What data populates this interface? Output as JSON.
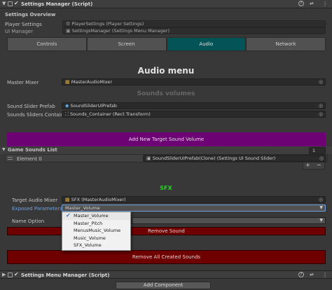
{
  "component1": {
    "title": "Settings Manager (Script)",
    "enabled_icon": "checkbox-icon",
    "help_icon": "?",
    "prefs_icon": "⇌",
    "menu_icon": "⋮"
  },
  "overview": {
    "title": "Settings Overview",
    "player_settings_label": "Player Settings",
    "player_settings_value": "PlayerSettings (Player Settings)",
    "ui_manager_label": "UI Manager",
    "ui_manager_value": "SettingsManager (Settings Menu Manager)"
  },
  "tabs": [
    {
      "label": "Controls",
      "active": false
    },
    {
      "label": "Screen",
      "active": false
    },
    {
      "label": "Audio",
      "active": true
    },
    {
      "label": "Network",
      "active": false
    }
  ],
  "audio": {
    "menu_title": "Audio menu",
    "master_mixer_label": "Master Mixer",
    "master_mixer_value": "MasterAudioMixer",
    "volumes_title": "Sounds volumes",
    "slider_prefab_label": "Sound Slider Prefab",
    "slider_prefab_value": "SoundSliderUIPrefab",
    "sliders_container_label": "Sounds Sliders Container",
    "sliders_container_value": "Sounds_Container (Rect Transform)",
    "add_button": "Add New Target Sound Volume"
  },
  "game_sounds": {
    "title": "Game Sounds List",
    "count": "1",
    "element_label": "Element 0",
    "element_value": "SoundSliderUIPrefab(Clone) (Settings UI Sound Slider)",
    "add_icon": "+",
    "remove_icon": "−"
  },
  "sfx": {
    "title": "SFX",
    "title_color": "#1fd61f",
    "mixer_label": "Target Audio Mixer",
    "mixer_value": "SFX (MasterAudioMixer)",
    "exposed_label": "Exposed Parameters",
    "exposed_value": "Master_Volume",
    "name_option_label": "Name Option",
    "remove_button": "Remove Sound",
    "remove_all_button": "Remove All Created Sounds"
  },
  "dropdown": {
    "options": [
      "Master_Volume",
      "Master_Pitch",
      "MenusMusic_Volume",
      "Music_Volume",
      "SFX_Volume"
    ],
    "selected": "Master_Volume"
  },
  "component2": {
    "title": "Settings Menu Manager (Script)"
  },
  "add_component": "Add Component",
  "colors": {
    "accent_tab": "#035456",
    "purple_button": "#6c0273",
    "red_button": "#6e0000",
    "exposed_label": "#6fa3e0"
  }
}
